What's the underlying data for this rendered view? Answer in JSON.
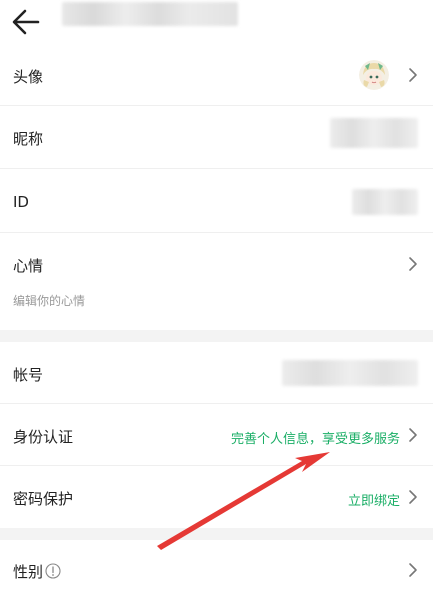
{
  "header": {
    "back_icon": "arrow-left-icon"
  },
  "profile": {
    "avatar": {
      "label": "头像",
      "icon": "avatar-image"
    },
    "nickname": {
      "label": "昵称"
    },
    "id": {
      "label": "ID"
    },
    "mood": {
      "label": "心情",
      "placeholder": "编辑你的心情"
    }
  },
  "account": {
    "account_label": "帐号",
    "verification": {
      "label": "身份认证",
      "hint": "完善个人信息，享受更多服务"
    },
    "password": {
      "label": "密码保护",
      "action": "立即绑定"
    }
  },
  "personal": {
    "gender": {
      "label": "性别",
      "info_icon": "info-icon"
    }
  },
  "colors": {
    "accent": "#1aae66",
    "annotation": "#e53935"
  }
}
